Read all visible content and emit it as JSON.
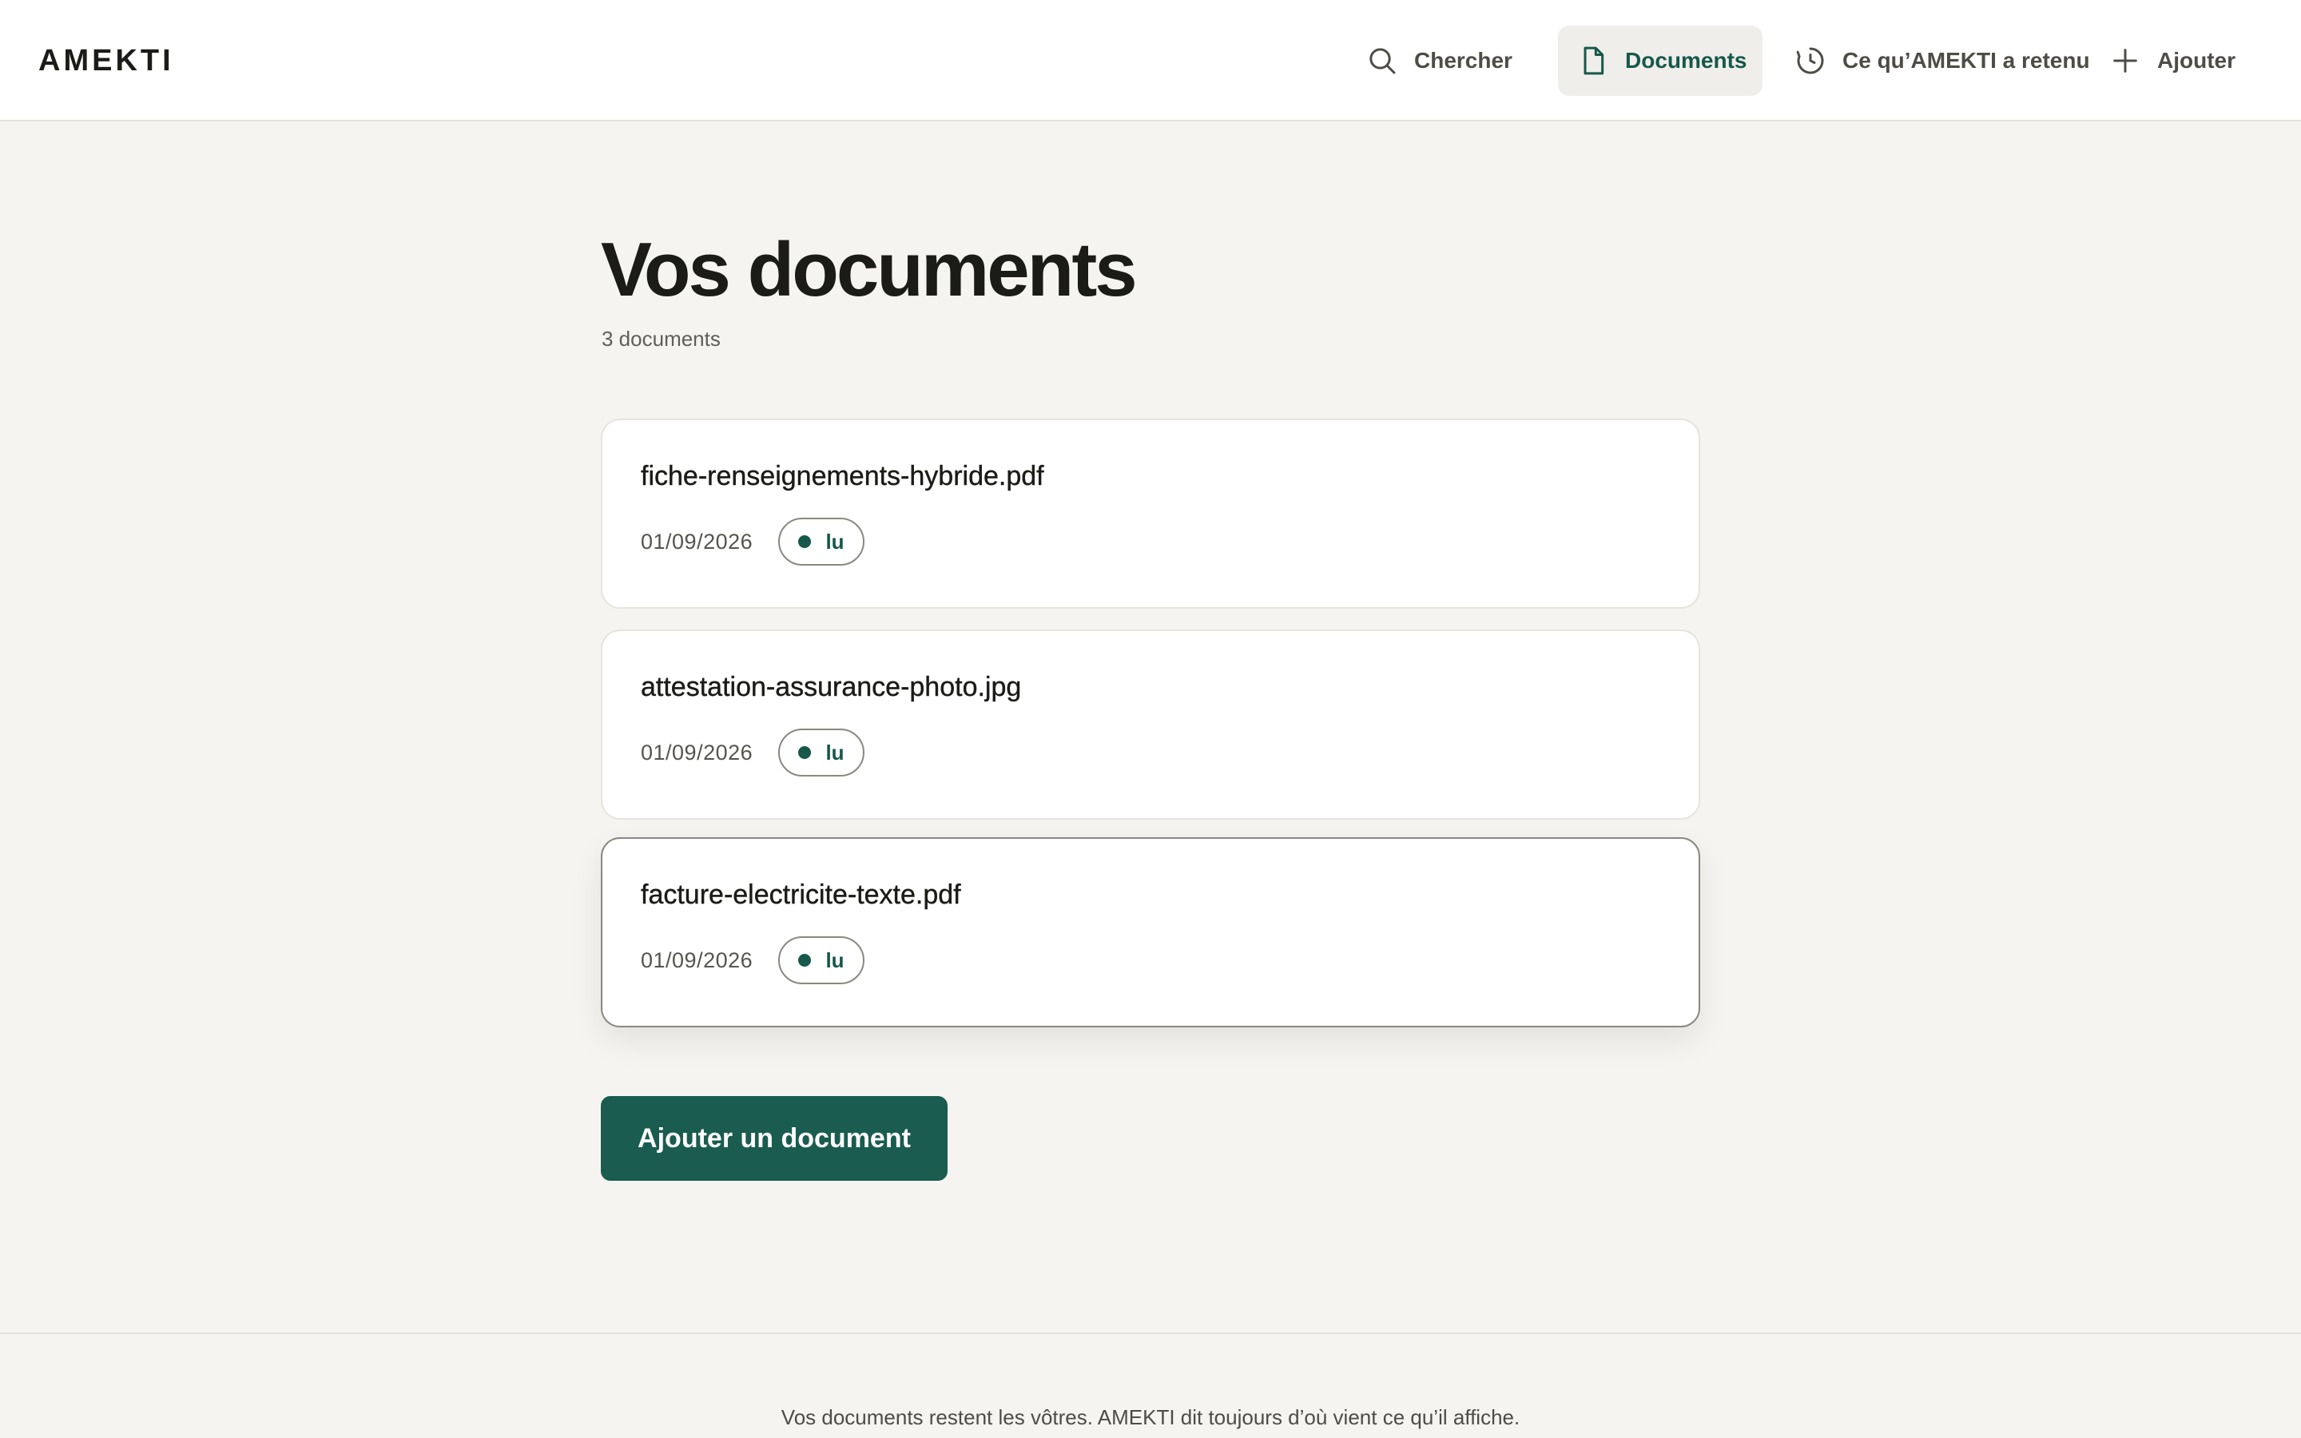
{
  "brand": "AMEKTI",
  "nav": {
    "search": {
      "label": "Chercher",
      "icon": "search-icon"
    },
    "documents": {
      "label": "Documents",
      "icon": "document-icon",
      "active": true
    },
    "memory": {
      "label": "Ce qu’AMEKTI a retenu",
      "icon": "history-icon"
    },
    "add": {
      "label": "Ajouter",
      "icon": "plus-icon"
    }
  },
  "page": {
    "title": "Vos documents",
    "count": "3 documents"
  },
  "documents": [
    {
      "name": "fiche-renseignements-hybride.pdf",
      "date": "01/09/2026",
      "status": "lu"
    },
    {
      "name": "attestation-assurance-photo.jpg",
      "date": "01/09/2026",
      "status": "lu"
    },
    {
      "name": "facture-electricite-texte.pdf",
      "date": "01/09/2026",
      "status": "lu"
    }
  ],
  "add_button": "Ajouter un document",
  "footer": "Vos documents restent les vôtres. AMEKTI dit toujours d’où vient ce qu’il affiche.",
  "colors": {
    "accent": "#1a5c4f",
    "background": "#f5f4f0",
    "card": "#ffffff"
  }
}
